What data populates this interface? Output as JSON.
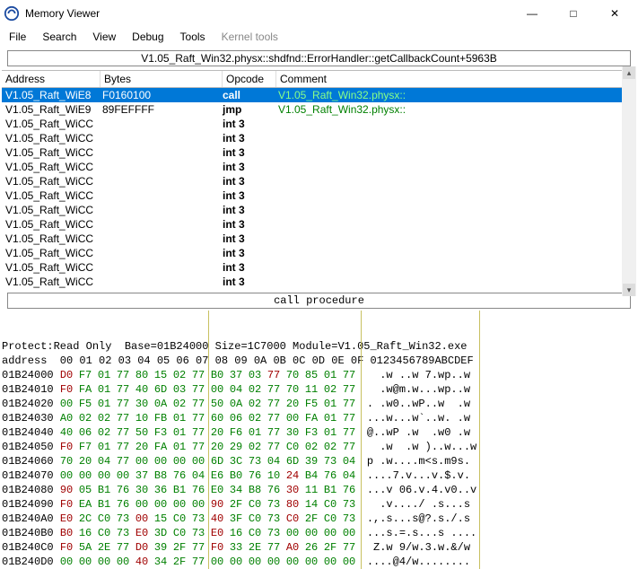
{
  "window": {
    "title": "Memory Viewer",
    "min": "—",
    "max": "□",
    "close": "✕"
  },
  "menu": [
    "File",
    "Search",
    "View",
    "Debug",
    "Tools",
    "Kernel tools"
  ],
  "location": "V1.05_Raft_Win32.physx::shdfnd::ErrorHandler::getCallbackCount+5963B",
  "dis_headers": {
    "address": "Address",
    "bytes": "Bytes",
    "opcode": "Opcode",
    "comment": "Comment"
  },
  "disasm": [
    {
      "addr": "V1.05_Raft_WiE8",
      "bytes": "F0160100",
      "op": "call",
      "comm": "V1.05_Raft_Win32.physx::",
      "sel": true
    },
    {
      "addr": "V1.05_Raft_WiE9",
      "bytes": "89FEFFFF",
      "op": "jmp",
      "comm": "V1.05_Raft_Win32.physx::"
    },
    {
      "addr": "V1.05_Raft_WiCC",
      "bytes": "",
      "op": "int 3",
      "comm": ""
    },
    {
      "addr": "V1.05_Raft_WiCC",
      "bytes": "",
      "op": "int 3",
      "comm": ""
    },
    {
      "addr": "V1.05_Raft_WiCC",
      "bytes": "",
      "op": "int 3",
      "comm": ""
    },
    {
      "addr": "V1.05_Raft_WiCC",
      "bytes": "",
      "op": "int 3",
      "comm": ""
    },
    {
      "addr": "V1.05_Raft_WiCC",
      "bytes": "",
      "op": "int 3",
      "comm": ""
    },
    {
      "addr": "V1.05_Raft_WiCC",
      "bytes": "",
      "op": "int 3",
      "comm": ""
    },
    {
      "addr": "V1.05_Raft_WiCC",
      "bytes": "",
      "op": "int 3",
      "comm": ""
    },
    {
      "addr": "V1.05_Raft_WiCC",
      "bytes": "",
      "op": "int 3",
      "comm": ""
    },
    {
      "addr": "V1.05_Raft_WiCC",
      "bytes": "",
      "op": "int 3",
      "comm": ""
    },
    {
      "addr": "V1.05_Raft_WiCC",
      "bytes": "",
      "op": "int 3",
      "comm": ""
    },
    {
      "addr": "V1.05_Raft_WiCC",
      "bytes": "",
      "op": "int 3",
      "comm": ""
    },
    {
      "addr": "V1.05_Raft_WiCC",
      "bytes": "",
      "op": "int 3",
      "comm": ""
    }
  ],
  "callproc": "call procedure",
  "hex_info": "Protect:Read Only  Base=01B24000 Size=1C7000 Module=V1.05_Raft_Win32.exe",
  "hex_header": "address  00 01 02 03 04 05 06 07 08 09 0A 0B 0C 0D 0E 0F 0123456789ABCDEF",
  "hex_rows": [
    {
      "addr": "01B24000",
      "hex": [
        "D0",
        "F7",
        "01",
        "77",
        "80",
        "15",
        "02",
        "77",
        "B0",
        "37",
        "03",
        "77",
        "70",
        "85",
        "01",
        "77"
      ],
      "red": [
        0,
        11
      ],
      "asc": "  .w ..w 7.wp..w"
    },
    {
      "addr": "01B24010",
      "hex": [
        "F0",
        "FA",
        "01",
        "77",
        "40",
        "6D",
        "03",
        "77",
        "00",
        "04",
        "02",
        "77",
        "70",
        "11",
        "02",
        "77"
      ],
      "red": [
        0
      ],
      "asc": "  .w@m.w...wp..w"
    },
    {
      "addr": "01B24020",
      "hex": [
        "00",
        "F5",
        "01",
        "77",
        "30",
        "0A",
        "02",
        "77",
        "50",
        "0A",
        "02",
        "77",
        "20",
        "F5",
        "01",
        "77"
      ],
      "red": [],
      "asc": ". .w0..wP..w  .w"
    },
    {
      "addr": "01B24030",
      "hex": [
        "A0",
        "02",
        "02",
        "77",
        "10",
        "FB",
        "01",
        "77",
        "60",
        "06",
        "02",
        "77",
        "00",
        "FA",
        "01",
        "77"
      ],
      "red": [],
      "asc": "...w...w`..w. .w"
    },
    {
      "addr": "01B24040",
      "hex": [
        "40",
        "06",
        "02",
        "77",
        "50",
        "F3",
        "01",
        "77",
        "20",
        "F6",
        "01",
        "77",
        "30",
        "F3",
        "01",
        "77"
      ],
      "red": [],
      "asc": "@..wP .w  .w0 .w"
    },
    {
      "addr": "01B24050",
      "hex": [
        "F0",
        "F7",
        "01",
        "77",
        "20",
        "FA",
        "01",
        "77",
        "20",
        "29",
        "02",
        "77",
        "C0",
        "02",
        "02",
        "77"
      ],
      "red": [
        0
      ],
      "asc": "  .w  .w )..w...w"
    },
    {
      "addr": "01B24060",
      "hex": [
        "70",
        "20",
        "04",
        "77",
        "00",
        "00",
        "00",
        "00",
        "6D",
        "3C",
        "73",
        "04",
        "6D",
        "39",
        "73",
        "04"
      ],
      "red": [],
      "asc": "p .w....m<s.m9s."
    },
    {
      "addr": "01B24070",
      "hex": [
        "00",
        "00",
        "00",
        "00",
        "37",
        "B8",
        "76",
        "04",
        "E6",
        "B0",
        "76",
        "10",
        "24",
        "B4",
        "76",
        "04"
      ],
      "red": [
        12
      ],
      "asc": "....7.v...v.$.v."
    },
    {
      "addr": "01B24080",
      "hex": [
        "90",
        "05",
        "B1",
        "76",
        "30",
        "36",
        "B1",
        "76",
        "E0",
        "34",
        "B8",
        "76",
        "30",
        "11",
        "B1",
        "76"
      ],
      "red": [
        0,
        12
      ],
      "asc": "...v 06.v.4.v0..v"
    },
    {
      "addr": "01B24090",
      "hex": [
        "F0",
        "EA",
        "B1",
        "76",
        "00",
        "00",
        "00",
        "00",
        "90",
        "2F",
        "C0",
        "73",
        "80",
        "14",
        "C0",
        "73"
      ],
      "red": [
        0,
        8,
        12
      ],
      "asc": "  .v..../ .s...s"
    },
    {
      "addr": "01B240A0",
      "hex": [
        "E0",
        "2C",
        "C0",
        "73",
        "00",
        "15",
        "C0",
        "73",
        "40",
        "3F",
        "C0",
        "73",
        "C0",
        "2F",
        "C0",
        "73"
      ],
      "red": [
        0,
        4,
        8,
        12
      ],
      "asc": ".,.s...s@?.s./.s"
    },
    {
      "addr": "01B240B0",
      "hex": [
        "B0",
        "16",
        "C0",
        "73",
        "E0",
        "3D",
        "C0",
        "73",
        "E0",
        "16",
        "C0",
        "73",
        "00",
        "00",
        "00",
        "00"
      ],
      "red": [
        0,
        4,
        8
      ],
      "asc": "...s.=.s...s ...."
    },
    {
      "addr": "01B240C0",
      "hex": [
        "F0",
        "5A",
        "2E",
        "77",
        "D0",
        "39",
        "2F",
        "77",
        "F0",
        "33",
        "2E",
        "77",
        "A0",
        "26",
        "2F",
        "77"
      ],
      "red": [
        0,
        4,
        8,
        12
      ],
      "asc": " Z.w 9/w.3.w.&/w"
    },
    {
      "addr": "01B240D0",
      "hex": [
        "00",
        "00",
        "00",
        "00",
        "40",
        "34",
        "2F",
        "77",
        "00",
        "00",
        "00",
        "00",
        "00",
        "00",
        "00",
        "00"
      ],
      "red": [
        4
      ],
      "asc": "....@4/w........"
    }
  ]
}
